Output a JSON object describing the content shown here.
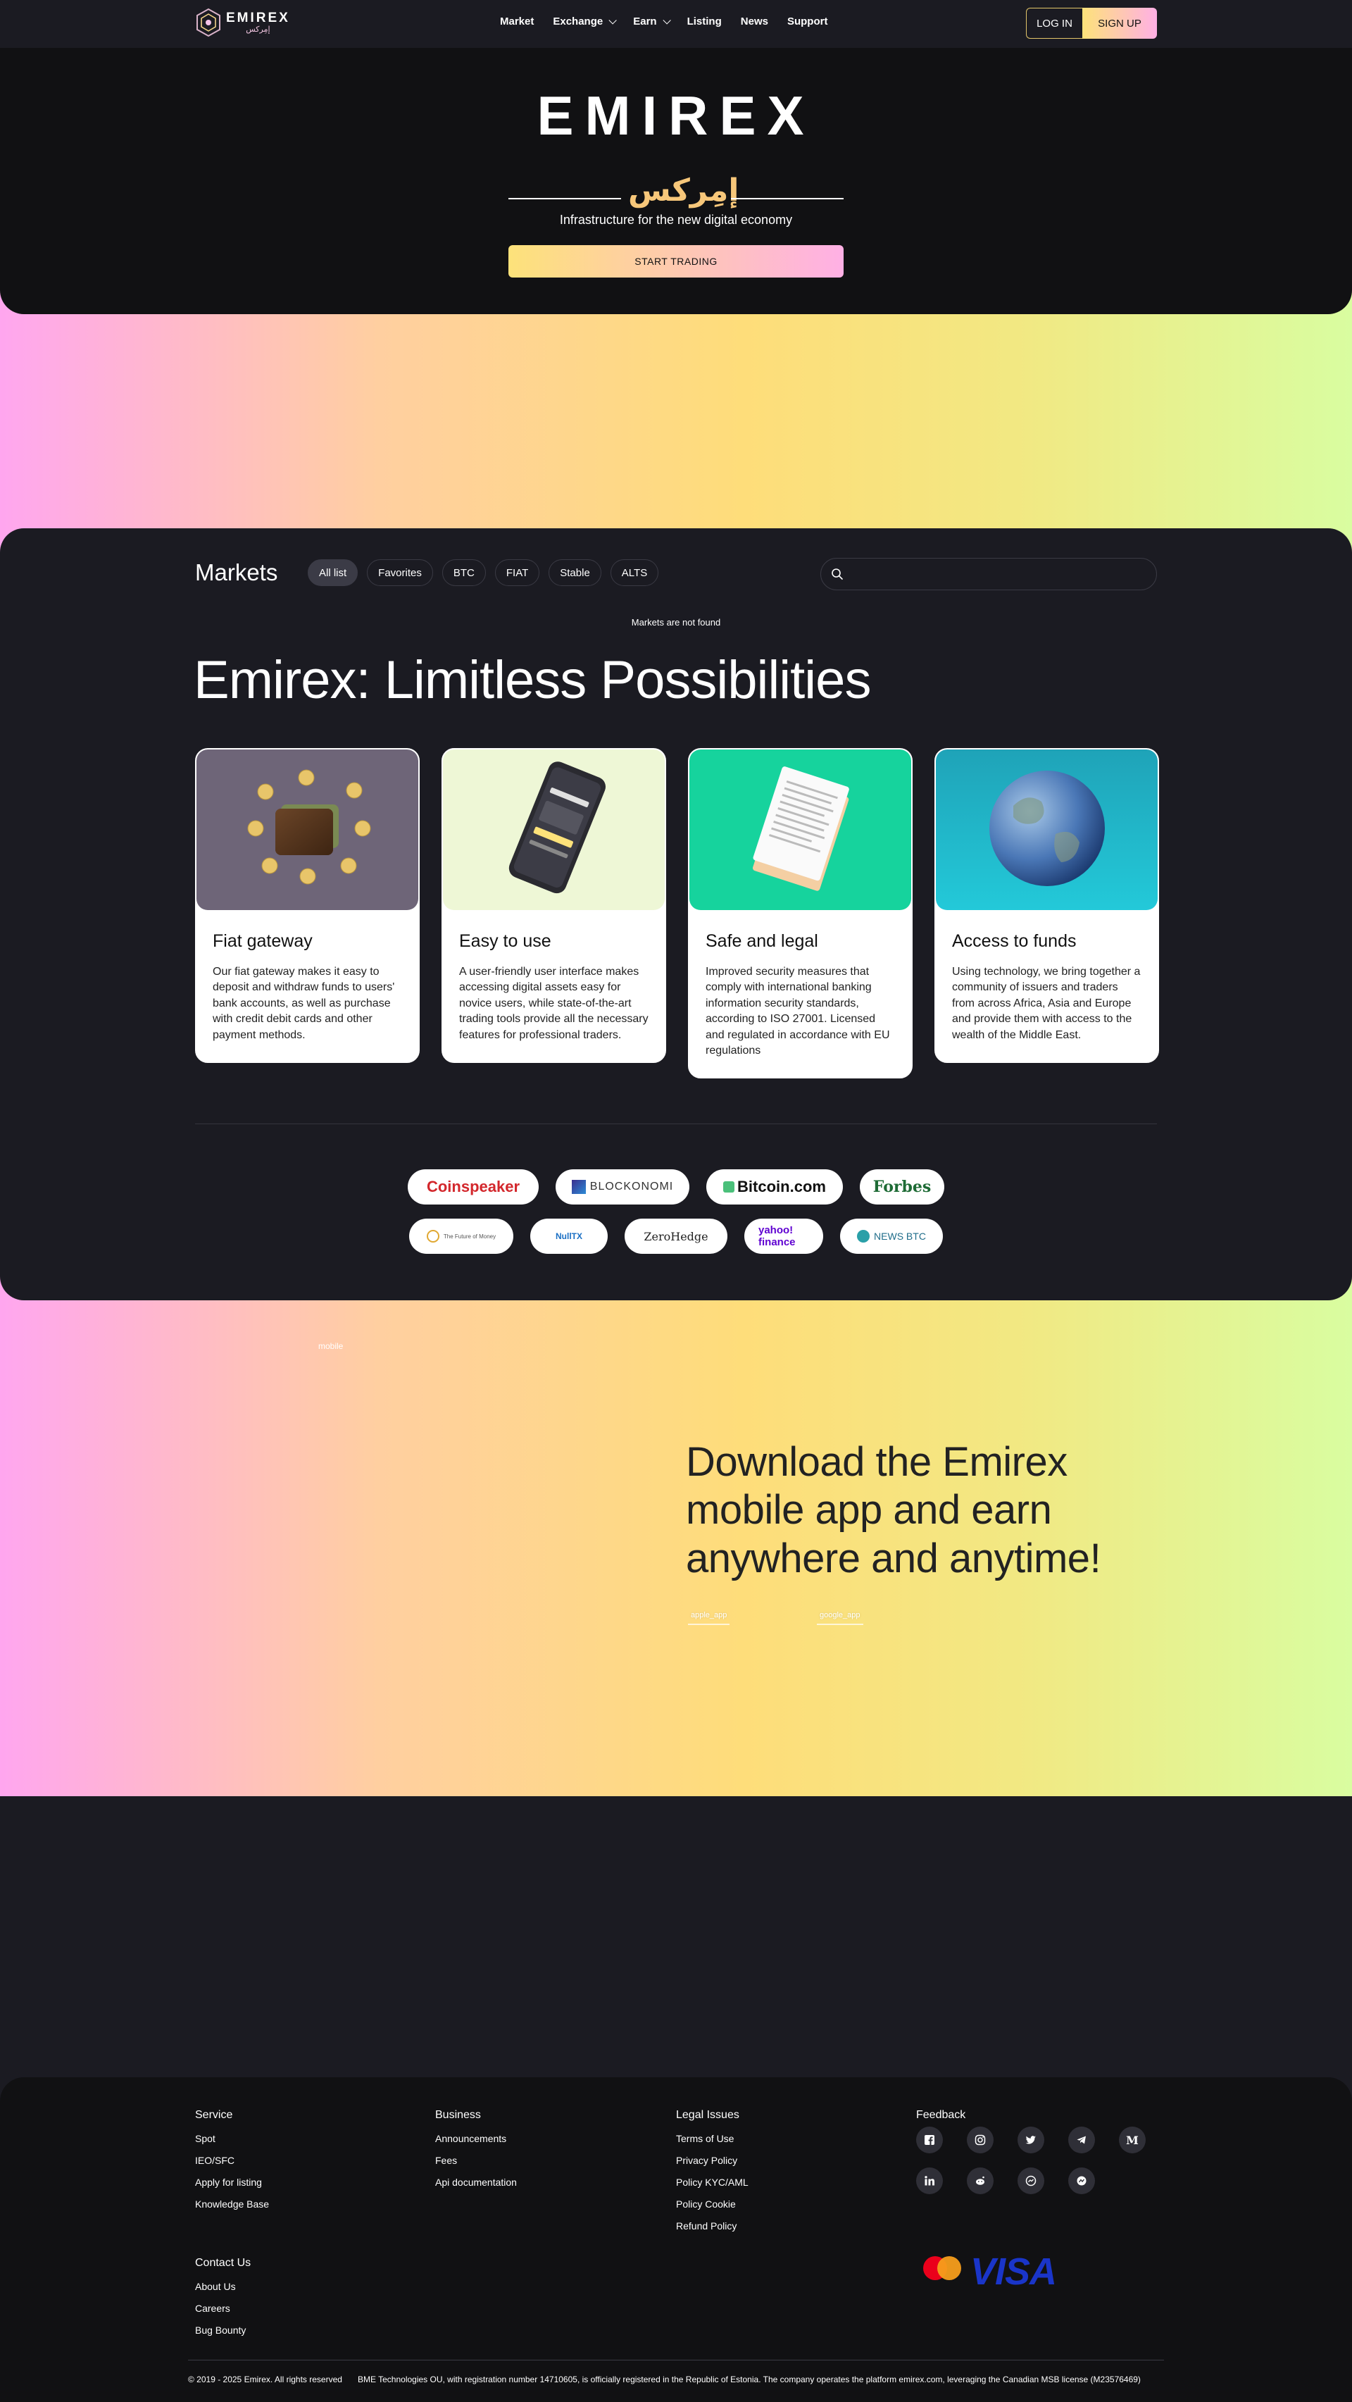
{
  "header": {
    "logo_text": "EMIREX",
    "logo_arabic": "إمِركس",
    "nav": [
      {
        "label": "Market"
      },
      {
        "label": "Exchange"
      },
      {
        "label": "Earn"
      },
      {
        "label": "Listing"
      },
      {
        "label": "News"
      },
      {
        "label": "Support"
      }
    ],
    "login_label": "LOG IN",
    "signup_label": "SIGN UP"
  },
  "hero": {
    "logo_text": "EMIREX",
    "logo_arabic": "إمِركس",
    "tagline": "Infrastructure for the new digital economy",
    "cta_label": "START TRADING"
  },
  "markets": {
    "title": "Markets",
    "tabs": [
      "All list",
      "Favorites",
      "BTC",
      "FIAT",
      "Stable",
      "ALTS"
    ],
    "active_tab": "All list",
    "search_placeholder": "",
    "empty_message": "Markets are not found"
  },
  "features": {
    "headline": "Emirex: Limitless Possibilities",
    "cards": [
      {
        "title": "Fiat gateway",
        "desc": "Our fiat gateway makes it easy to deposit and withdraw funds to users' bank accounts, as well as purchase with credit debit cards and other payment methods.",
        "icon": "wallet-coins-image"
      },
      {
        "title": "Easy to use",
        "desc": "A user-friendly user interface makes accessing digital assets easy for novice users, while state-of-the-art trading tools provide all the necessary features for professional traders.",
        "icon": "phone-app-image"
      },
      {
        "title": "Safe and legal",
        "desc": "Improved security measures that comply with international banking information security standards, according to ISO 27001. Licensed and regulated in accordance with EU regulations",
        "icon": "legal-document-image"
      },
      {
        "title": "Access to funds",
        "desc": "Using technology, we bring together a community of issuers and traders from across Africa, Asia and Europe and provide them with access to the wealth of the Middle East.",
        "icon": "globe-image"
      }
    ]
  },
  "press": {
    "row1": [
      "Coinspeaker",
      "BLOCKONOMI",
      "Bitcoin.com",
      "Forbes"
    ],
    "row2": [
      "The Future of Money",
      "NullTX",
      "ZeroHedge",
      "yahoo! finance",
      "NEWS BTC"
    ]
  },
  "mobile": {
    "label": "mobile",
    "title": "Download the Emirex mobile app and earn anywhere and anytime!",
    "store_apple": "apple_app",
    "store_google": "google_app"
  },
  "footer": {
    "service": {
      "head": "Service",
      "links": [
        "Spot",
        "IEO/SFC",
        "Apply for listing",
        "Knowledge Base"
      ]
    },
    "business": {
      "head": "Business",
      "links": [
        "Announcements",
        "Fees",
        "Api documentation"
      ]
    },
    "legal": {
      "head": "Legal Issues",
      "links": [
        "Terms of Use",
        "Privacy Policy",
        "Policy KYC/AML",
        "Policy Cookie",
        "Refund Policy"
      ]
    },
    "feedback": {
      "head": "Feedback"
    },
    "contact": {
      "head": "Contact Us",
      "links": [
        "About Us",
        "Careers",
        "Bug Bounty"
      ]
    },
    "social_icons": [
      "facebook-icon",
      "instagram-icon",
      "twitter-icon",
      "telegram-icon",
      "medium-icon",
      "linkedin-icon",
      "reddit-icon",
      "messenger-icon",
      "coinmarketcap-icon"
    ],
    "payment_logos": {
      "visa": "VISA"
    },
    "copyright": "© 2019 - 2025 Emirex. All rights reserved",
    "legal_text": "BME Technologies OU, with registration number 14710605, is officially registered in the Republic of Estonia. The company operates the platform emirex.com, leveraging the Canadian MSB license (M23576469)"
  },
  "colors": {
    "accent_yellow": "#fde27a",
    "accent_pink": "#ffb0e5",
    "dark_bg": "#1b1b22",
    "hero_bg": "#111113"
  }
}
